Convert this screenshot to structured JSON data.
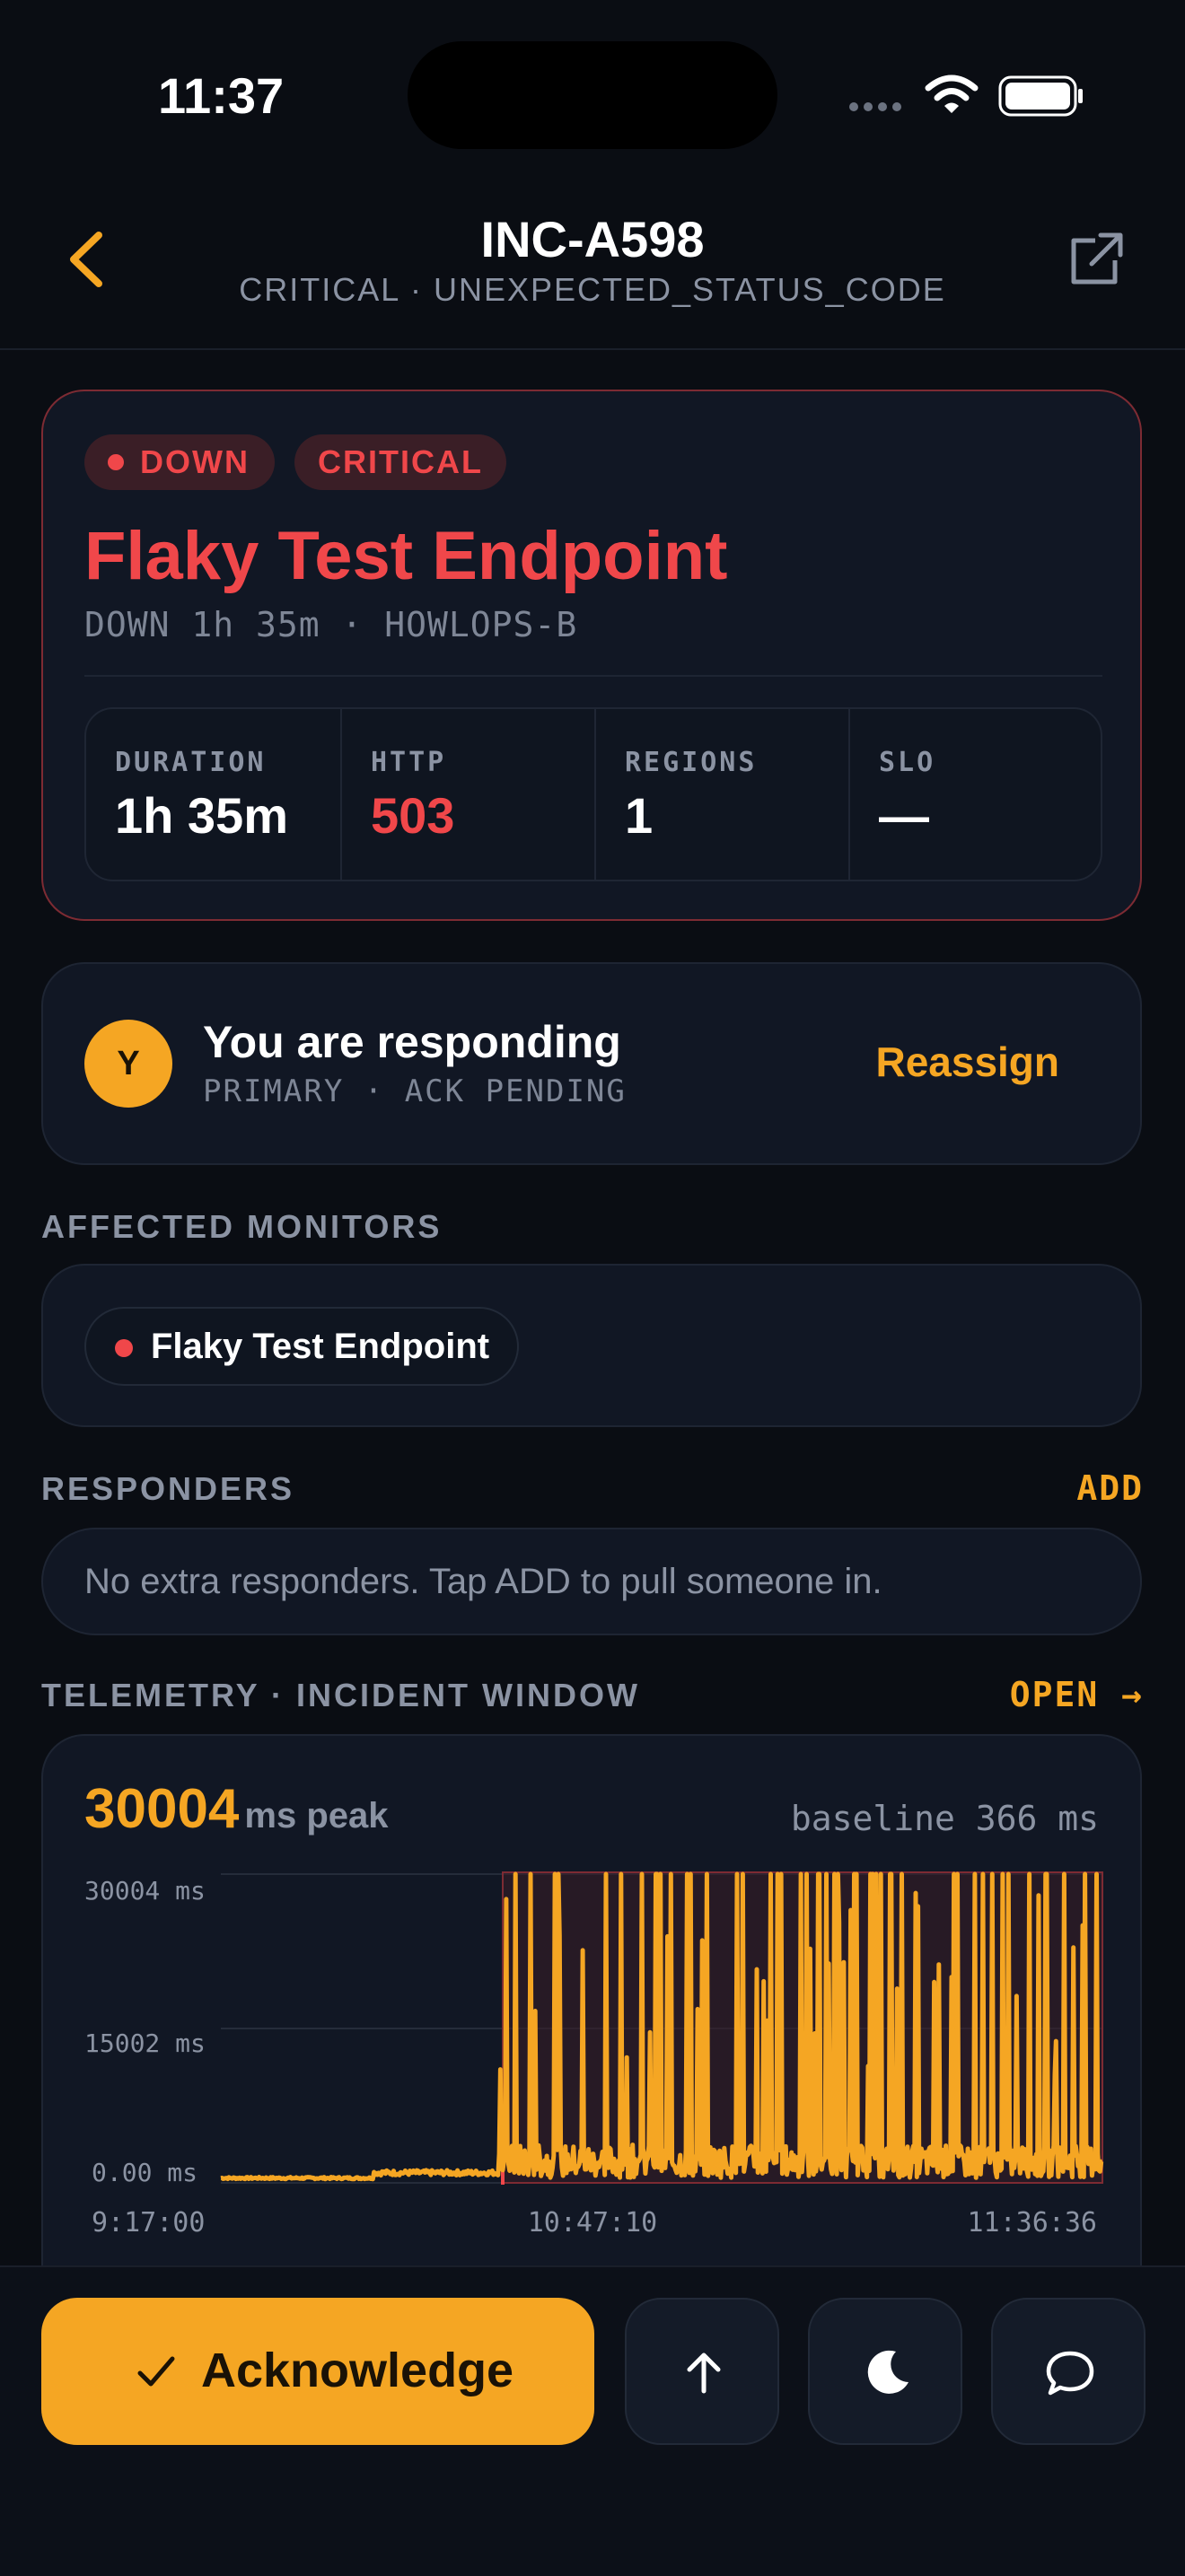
{
  "status_bar": {
    "time": "11:37"
  },
  "nav": {
    "title": "INC-A598",
    "subtitle": "CRITICAL · UNEXPECTED_STATUS_CODE"
  },
  "incident": {
    "status_pill": "DOWN",
    "severity_pill": "CRITICAL",
    "title": "Flaky Test Endpoint",
    "subtitle": "DOWN 1h 35m · HOWLOPS-B",
    "stats": [
      {
        "label": "DURATION",
        "value": "1h 35m"
      },
      {
        "label": "HTTP",
        "value": "503"
      },
      {
        "label": "REGIONS",
        "value": "1"
      },
      {
        "label": "SLO",
        "value": "—"
      }
    ]
  },
  "responder": {
    "avatar_initial": "Y",
    "title": "You are responding",
    "subtitle": "PRIMARY · ACK PENDING",
    "action": "Reassign"
  },
  "affected_monitors": {
    "label": "AFFECTED MONITORS",
    "items": [
      {
        "name": "Flaky Test Endpoint",
        "status_color": "#f0474a"
      }
    ]
  },
  "responders": {
    "label": "RESPONDERS",
    "action": "ADD",
    "empty_text": "No extra responders. Tap ADD to pull someone in."
  },
  "telemetry": {
    "label": "TELEMETRY · INCIDENT WINDOW",
    "action": "OPEN →",
    "peak_value": "30004",
    "peak_unit": "ms peak",
    "baseline": "baseline 366 ms"
  },
  "chart_data": {
    "type": "line",
    "title": "",
    "xlabel": "",
    "ylabel": "",
    "y_ticks": [
      "30004 ms",
      "15002 ms",
      "0.00 ms"
    ],
    "x_ticks": [
      "9:17:00",
      "10:47:10",
      "11:36:36"
    ],
    "ylim": [
      0,
      30004
    ],
    "incident_start": "10:50:00",
    "series": [
      {
        "color": "#f5a623",
        "x_start": "9:17:00",
        "x_end": "11:36:36",
        "baseline_ms": 366,
        "peak_ms": 30004
      }
    ]
  },
  "actions": {
    "acknowledge": "Acknowledge",
    "escalate_icon": "arrow-up-icon",
    "snooze_icon": "moon-icon",
    "comment_icon": "chat-bubble-icon"
  },
  "colors": {
    "accent": "#f5a623",
    "danger": "#f0474a",
    "background": "#0a0d13",
    "card": "#111724"
  }
}
